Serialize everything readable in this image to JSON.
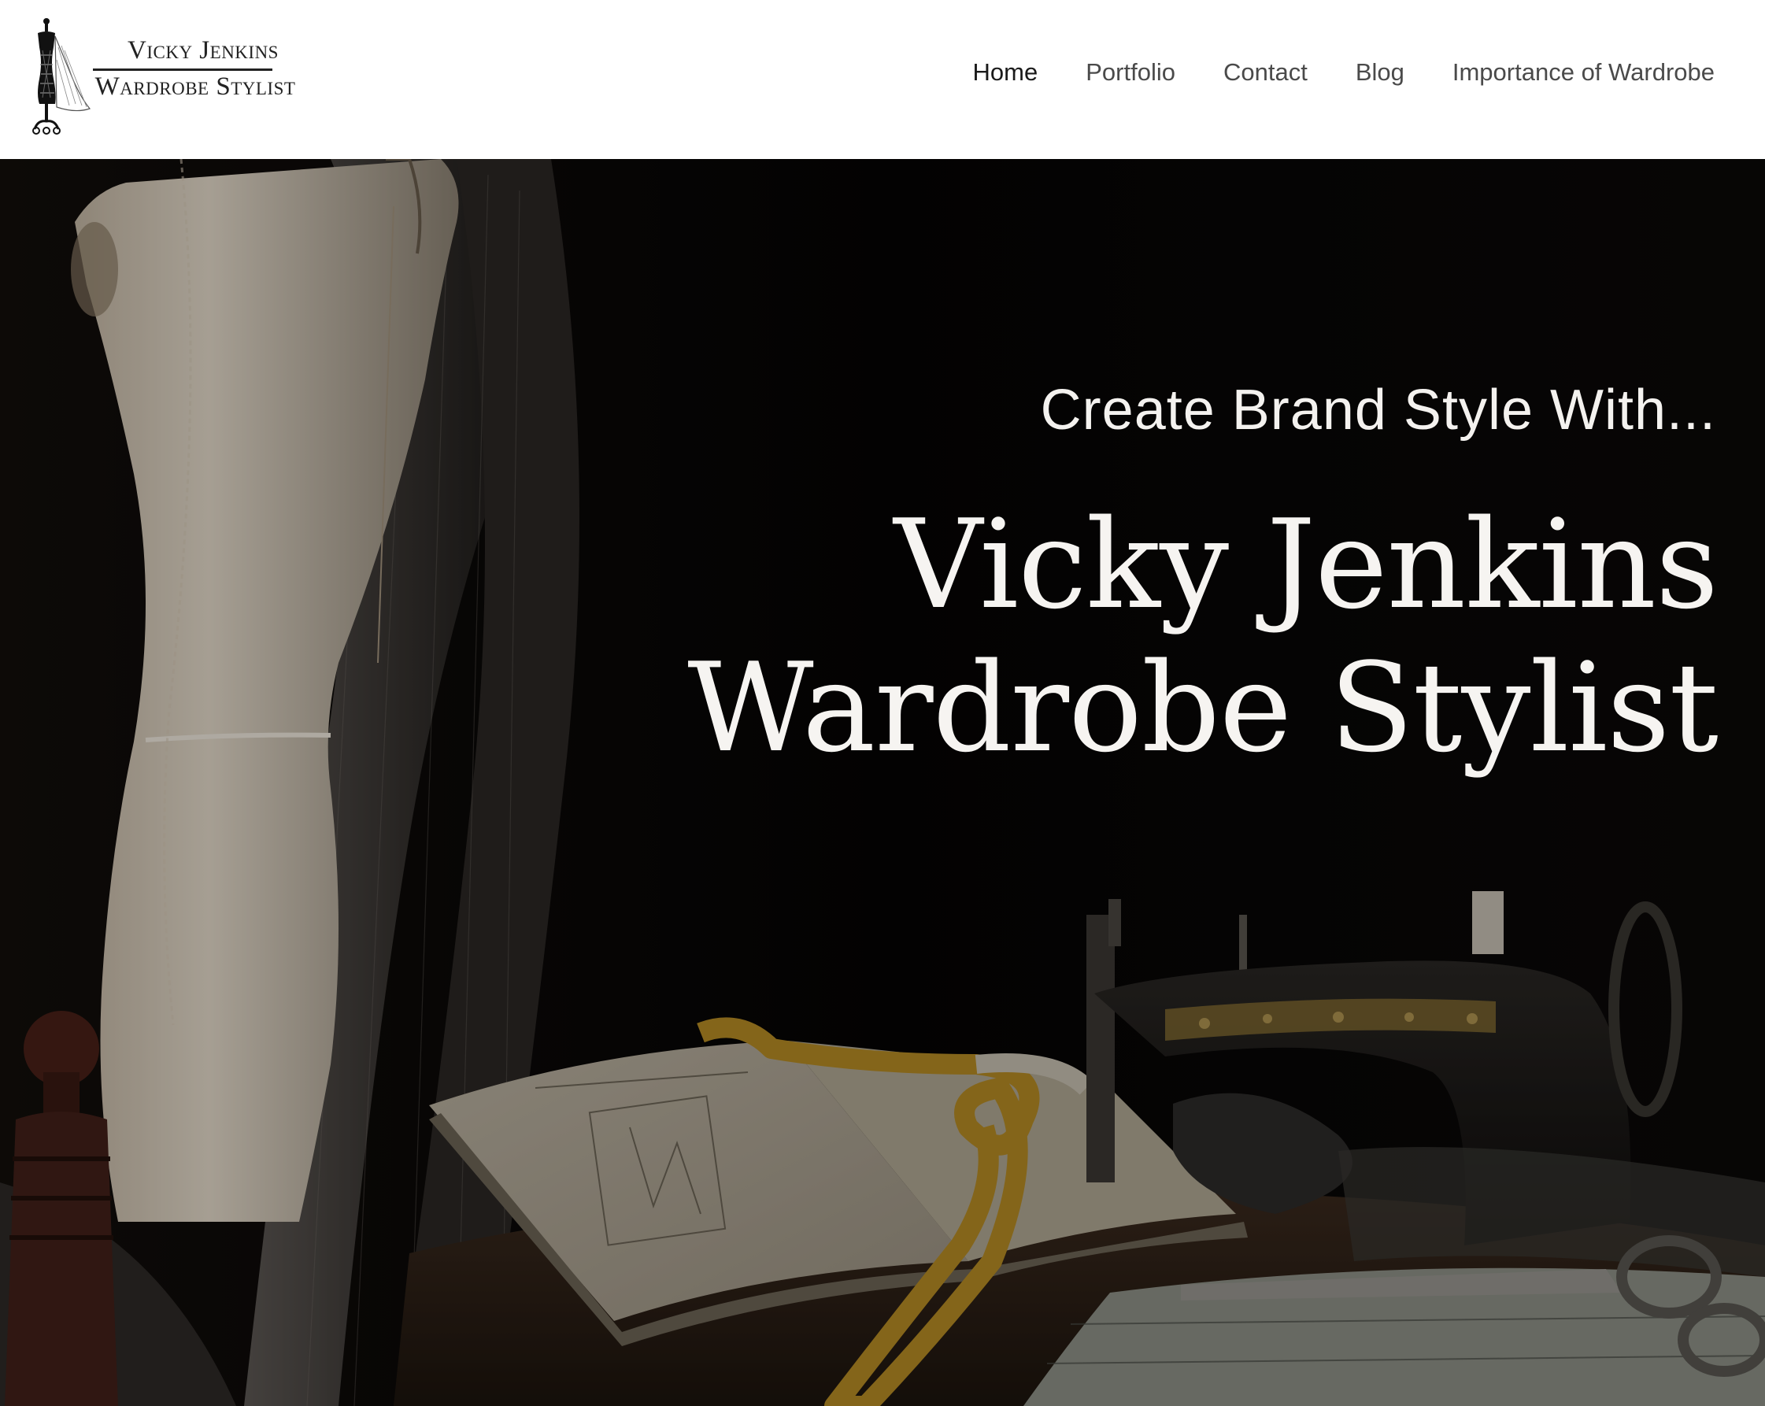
{
  "logo": {
    "line1": "Vicky Jenkins",
    "line2": "Wardrobe Stylist"
  },
  "nav": {
    "items": [
      {
        "label": "Home"
      },
      {
        "label": "Portfolio"
      },
      {
        "label": "Contact"
      },
      {
        "label": "Blog"
      },
      {
        "label": "Importance of Wardrobe"
      }
    ]
  },
  "hero": {
    "tagline": "Create Brand Style With...",
    "title_line1": "Vicky Jenkins",
    "title_line2": "Wardrobe Stylist"
  },
  "colors": {
    "header_bg": "#ffffff",
    "nav_text": "#4a4a4a",
    "hero_bg": "#060504",
    "hero_text": "#f6f4f1"
  },
  "icons": {
    "logo": "mannequin-icon"
  }
}
